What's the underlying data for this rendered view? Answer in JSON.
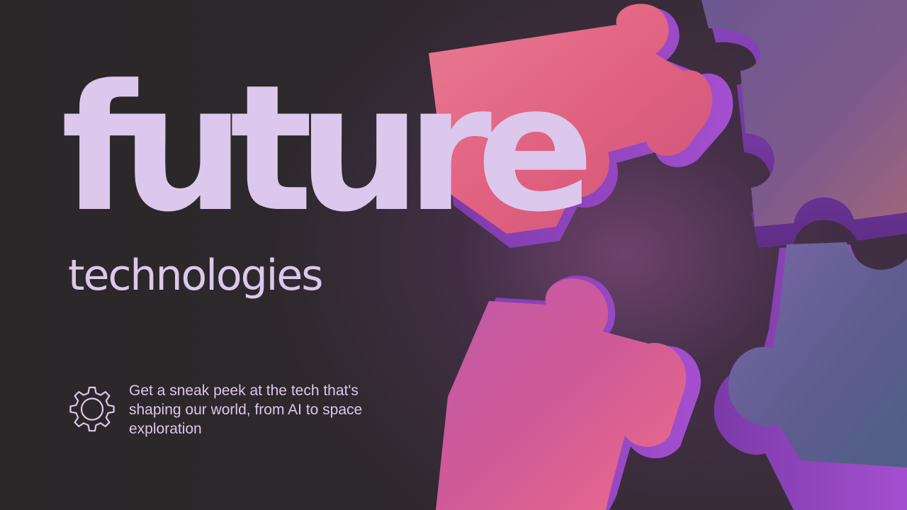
{
  "hero": {
    "title": "future",
    "subtitle": "technologies"
  },
  "feature": {
    "icon": "gear-icon",
    "text": "Get a sneak peek at the tech that's shaping our world, from AI to space exploration"
  },
  "colors": {
    "text": "#dcc8ec",
    "background": "#2a2629",
    "puzzle_pink": "#e86c8c",
    "puzzle_purple": "#9b4fc0",
    "puzzle_slate": "#6a5a90"
  }
}
